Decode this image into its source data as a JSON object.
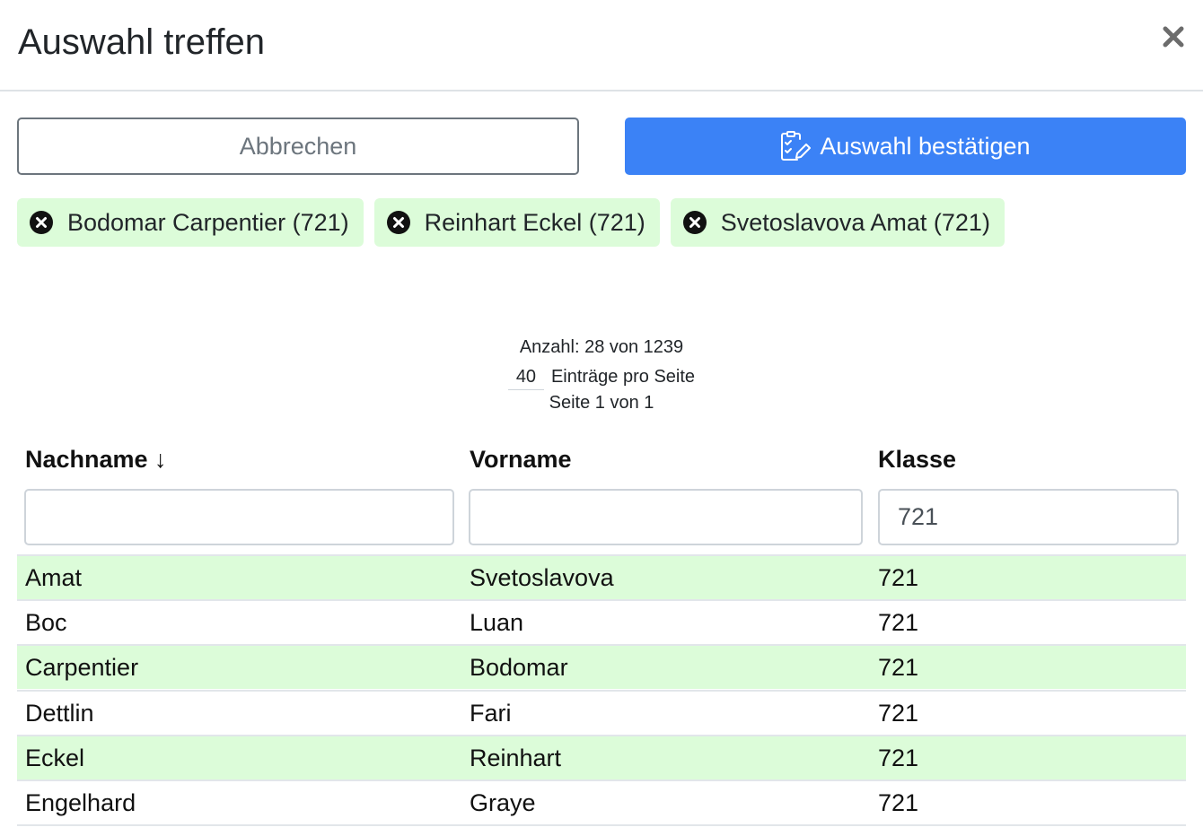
{
  "modal": {
    "title": "Auswahl treffen",
    "close_icon": "close-icon"
  },
  "actions": {
    "cancel_label": "Abbrechen",
    "confirm_label": "Auswahl bestätigen",
    "confirm_icon": "edit-checklist-icon"
  },
  "selected_chips": [
    {
      "label": "Bodomar Carpentier (721)"
    },
    {
      "label": "Reinhart Eckel (721)"
    },
    {
      "label": "Svetoslavova Amat (721)"
    }
  ],
  "pagination": {
    "count_text": "Anzahl: 28 von 1239",
    "page_size": "40",
    "page_size_suffix": "Einträge pro Seite",
    "page_text": "Seite 1 von 1"
  },
  "table": {
    "columns": [
      {
        "label": "Nachname ↓",
        "sorted": "descending-arrow"
      },
      {
        "label": "Vorname"
      },
      {
        "label": "Klasse"
      }
    ],
    "filters": {
      "nachname": "",
      "vorname": "",
      "klasse": "721"
    },
    "rows": [
      {
        "nachname": "Amat",
        "vorname": "Svetoslavova",
        "klasse": "721",
        "selected": true
      },
      {
        "nachname": "Boc",
        "vorname": "Luan",
        "klasse": "721",
        "selected": false
      },
      {
        "nachname": "Carpentier",
        "vorname": "Bodomar",
        "klasse": "721",
        "selected": true
      },
      {
        "nachname": "Dettlin",
        "vorname": "Fari",
        "klasse": "721",
        "selected": false
      },
      {
        "nachname": "Eckel",
        "vorname": "Reinhart",
        "klasse": "721",
        "selected": true
      },
      {
        "nachname": "Engelhard",
        "vorname": "Graye",
        "klasse": "721",
        "selected": false
      }
    ]
  },
  "colors": {
    "primary": "#3b82f6",
    "selected_bg": "#dcfcd9",
    "secondary": "#6c757d"
  }
}
